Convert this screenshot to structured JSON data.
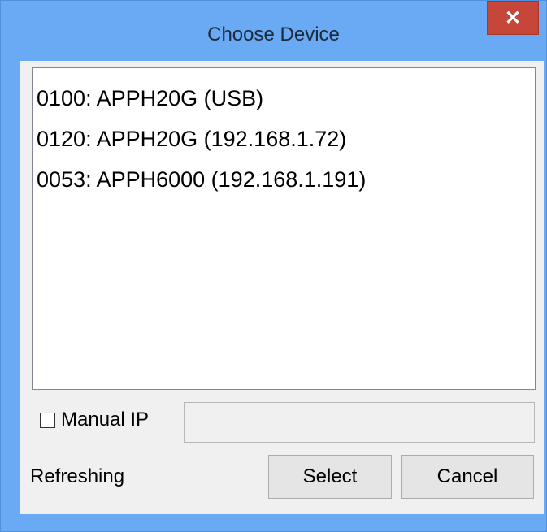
{
  "window": {
    "title": "Choose Device",
    "close_label": "✕"
  },
  "devices": [
    "0100: APPH20G (USB)",
    "0120: APPH20G (192.168.1.72)",
    "0053: APPH6000 (192.168.1.191)"
  ],
  "manual_ip": {
    "label": "Manual IP",
    "checked": false,
    "value": ""
  },
  "status": "Refreshing",
  "buttons": {
    "select": "Select",
    "cancel": "Cancel"
  },
  "colors": {
    "title_bar": "#6aa9f4",
    "close_button": "#c7463a",
    "dialog_background": "#f0f0f0"
  }
}
